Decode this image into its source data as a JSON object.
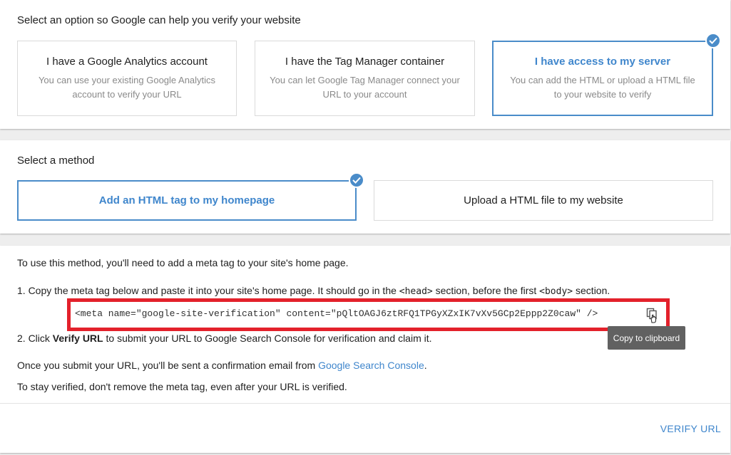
{
  "verify_options": {
    "title": "Select an option so Google can help you verify your website",
    "items": [
      {
        "title": "I have a Google Analytics account",
        "desc": "You can use your existing Google Analytics account to verify your URL"
      },
      {
        "title": "I have the Tag Manager container",
        "desc": "You can let Google Tag Manager connect your URL to your account"
      },
      {
        "title": "I have access to my server",
        "desc": "You can add the HTML or upload a HTML file to your website to verify"
      }
    ]
  },
  "method": {
    "title": "Select a method",
    "items": [
      {
        "label": "Add an HTML tag to my homepage"
      },
      {
        "label": "Upload a HTML file to my website"
      }
    ]
  },
  "instructions": {
    "intro": "To use this method, you'll need to add a meta tag to your site's home page.",
    "step1_prefix": "1. Copy the meta tag below and paste it into your site's home page. It should go in the ",
    "step1_head": "<head>",
    "step1_mid": " section, before the first ",
    "step1_body": "<body>",
    "step1_suffix": " section.",
    "meta_tag": "<meta name=\"google-site-verification\" content=\"pQltOAGJ6ztRFQ1TPGyXZxIK7vXv5GCp2Eppp2Z0caw\" />",
    "copy_tooltip": "Copy to clipboard",
    "step2_prefix": "2. Click ",
    "step2_bold": "Verify URL",
    "step2_suffix": " to submit your URL to Google Search Console for verification and claim it.",
    "confirm_prefix": "Once you submit your URL, you'll be sent a confirmation email from ",
    "confirm_link": "Google Search Console",
    "confirm_suffix": ".",
    "stay_verified": "To stay verified, don't remove the meta tag, even after your URL is verified.",
    "verify_button": "VERIFY URL"
  },
  "colors": {
    "accent": "#4a8cc9",
    "highlight_border": "#e3212b",
    "tooltip_bg": "#616161"
  },
  "icons": [
    "check-icon",
    "copy-icon",
    "hand-cursor-icon"
  ]
}
